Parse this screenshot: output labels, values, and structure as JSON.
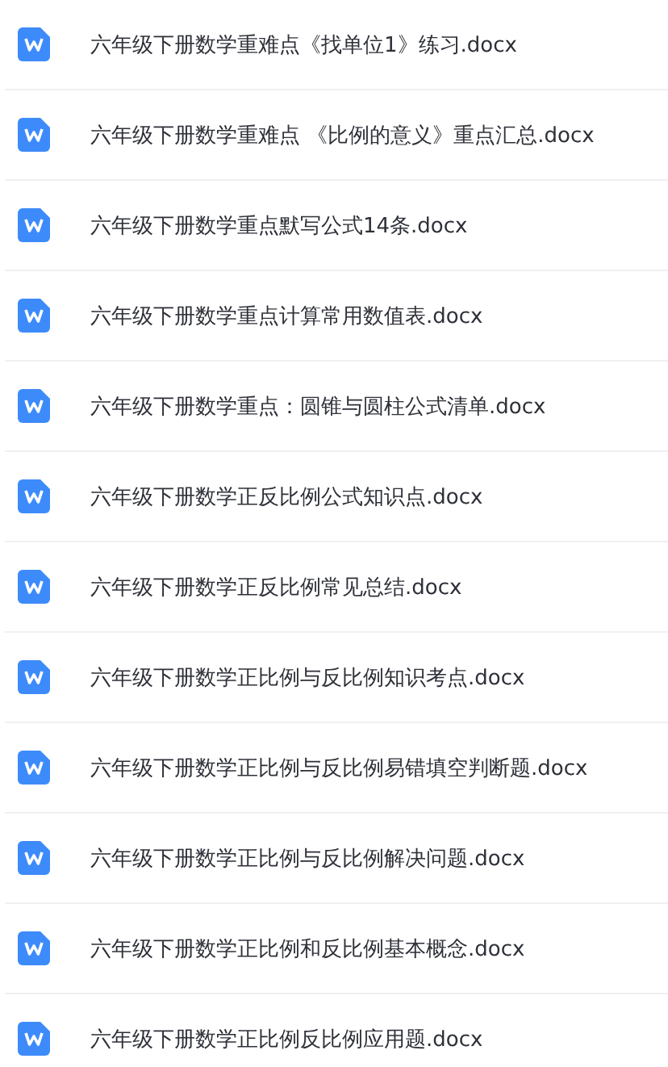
{
  "files": [
    {
      "name": "六年级下册数学重难点《找单位1》练习.docx"
    },
    {
      "name": "六年级下册数学重难点 《比例的意义》重点汇总.docx"
    },
    {
      "name": "六年级下册数学重点默写公式14条.docx"
    },
    {
      "name": "六年级下册数学重点计算常用数值表.docx"
    },
    {
      "name": "六年级下册数学重点：圆锥与圆柱公式清单.docx"
    },
    {
      "name": "六年级下册数学正反比例公式知识点.docx"
    },
    {
      "name": "六年级下册数学正反比例常见总结.docx"
    },
    {
      "name": "六年级下册数学正比例与反比例知识考点.docx"
    },
    {
      "name": "六年级下册数学正比例与反比例易错填空判断题.docx"
    },
    {
      "name": "六年级下册数学正比例与反比例解决问题.docx"
    },
    {
      "name": "六年级下册数学正比例和反比例基本概念.docx"
    },
    {
      "name": "六年级下册数学正比例反比例应用题.docx"
    }
  ]
}
